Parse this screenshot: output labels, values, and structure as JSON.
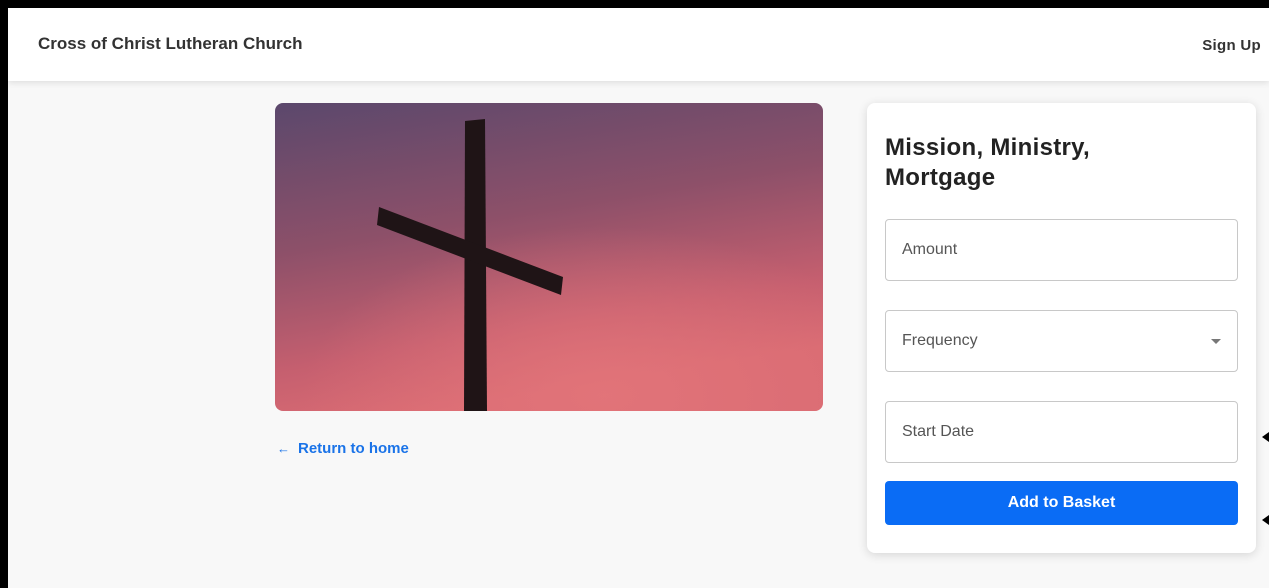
{
  "header": {
    "brand": "Cross of Christ Lutheran Church",
    "signup_label": "Sign Up"
  },
  "hero": {
    "image": "cross-silhouette-at-sunset",
    "colors": {
      "top": "#5e4a6e",
      "middle": "#9a556c",
      "bottom": "#d86a72",
      "cross": "#1f1416"
    }
  },
  "return_link": {
    "arrow": "←",
    "label": "Return to home"
  },
  "form": {
    "title": "Mission, Ministry, Mortgage",
    "amount_placeholder": "Amount",
    "frequency_placeholder": "Frequency",
    "start_date_placeholder": "Start Date",
    "submit_label": "Add to Basket"
  },
  "colors": {
    "accent": "#0a6cf5",
    "link": "#1a73e8",
    "page_bg": "#f8f8f8"
  }
}
